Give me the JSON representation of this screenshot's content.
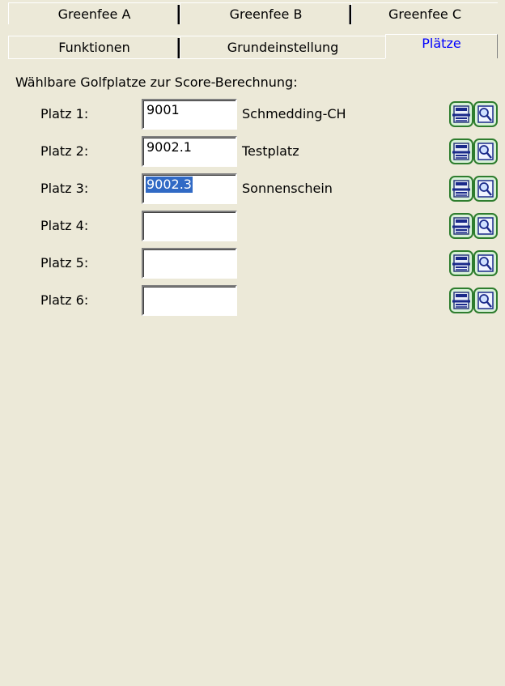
{
  "tabs": {
    "row1": [
      {
        "label": "Greenfee A"
      },
      {
        "label": "Greenfee B"
      },
      {
        "label": "Greenfee C"
      }
    ],
    "row2": [
      {
        "label": "Funktionen"
      },
      {
        "label": "Grundeinstellung"
      },
      {
        "label": "Plätze",
        "active": true
      }
    ]
  },
  "group_label": "Wählbare Golfplatze zur Score-Berechnung:",
  "courses": [
    {
      "label": "Platz 1:",
      "value": "9001",
      "name": "Schmedding-CH"
    },
    {
      "label": "Platz 2:",
      "value": "9002.1",
      "name": "Testplatz"
    },
    {
      "label": "Platz 3:",
      "value": "9002.3",
      "name": "Sonnenschein",
      "selected": true
    },
    {
      "label": "Platz 4:",
      "value": "",
      "name": ""
    },
    {
      "label": "Platz 5:",
      "value": "",
      "name": ""
    },
    {
      "label": "Platz 6:",
      "value": "",
      "name": ""
    }
  ],
  "icons": {
    "list": "list-icon",
    "search": "search-icon"
  },
  "colors": {
    "background": "#ece9d8",
    "active_tab_text": "#0000ff",
    "selection": "#316ac5",
    "icon_border": "#2e7d2e"
  }
}
